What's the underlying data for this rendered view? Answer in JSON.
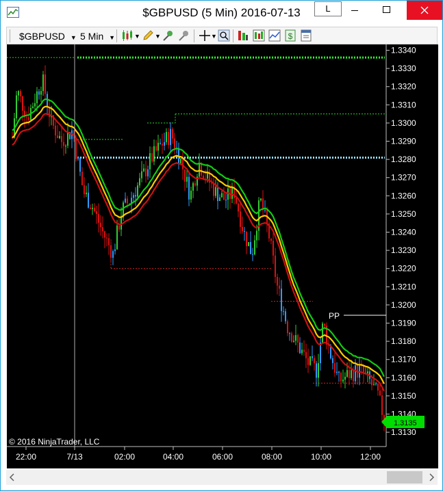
{
  "window": {
    "title": "$GBPUSD (5 Min)  2016-07-13",
    "tooltip": "L"
  },
  "toolbar": {
    "instrument": "$GBPUSD",
    "interval": "5 Min"
  },
  "chart": {
    "copyright": "© 2016 NinjaTrader, LLC",
    "pivot_label": "PP",
    "last_price": "1.3135",
    "price_ticks": [
      "1.3340",
      "1.3330",
      "1.3320",
      "1.3310",
      "1.3300",
      "1.3290",
      "1.3280",
      "1.3270",
      "1.3260",
      "1.3250",
      "1.3240",
      "1.3230",
      "1.3220",
      "1.3210",
      "1.3200",
      "1.3190",
      "1.3180",
      "1.3170",
      "1.3160",
      "1.3150",
      "1.3140",
      "1.3130"
    ],
    "time_ticks": [
      "22:00",
      "7/13",
      "02:00",
      "04:00",
      "06:00",
      "08:00",
      "10:00",
      "12:00"
    ]
  },
  "chart_data": {
    "type": "candlestick",
    "y_range": [
      1.3127,
      1.3343
    ],
    "x_labels": [
      "22:00",
      "7/13",
      "02:00",
      "04:00",
      "06:00",
      "08:00",
      "10:00",
      "12:00"
    ],
    "price_levels": {
      "top_resistance": 1.3336,
      "r_level": 1.3305,
      "pivot_cyan": 1.3281,
      "left_level": 1.3291,
      "upper_level": 1.33,
      "support_level": 1.322,
      "pp": 1.3194,
      "low_level": 1.3157,
      "last": 1.3135
    },
    "colors": {
      "up_candle": "#33cc33",
      "down_candle": "#dd1111",
      "neutral_candle": "#3399ff",
      "ema_fast": "#cc1111",
      "ema_mid": "#ffcc00",
      "ema_slow": "#11cc11",
      "last_price_tag": "#00dd00"
    }
  }
}
